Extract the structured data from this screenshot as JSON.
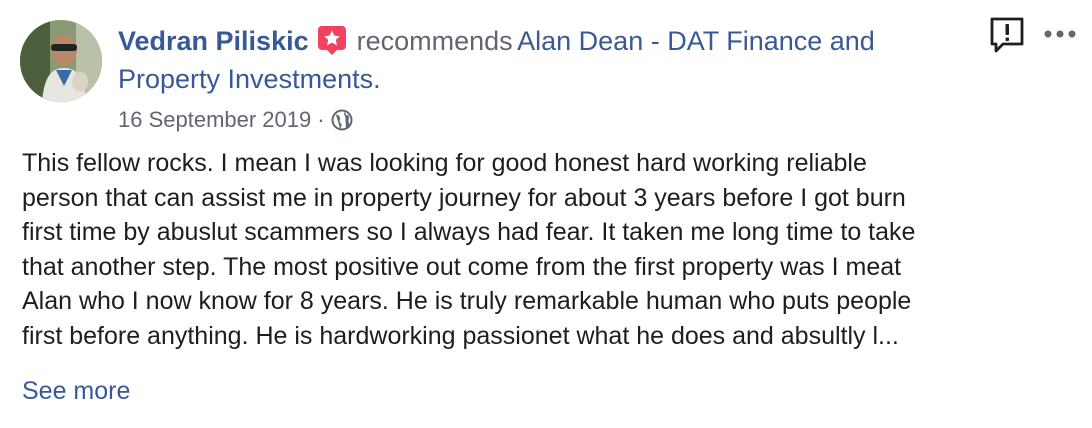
{
  "author": {
    "name": "Vedran Piliskic",
    "avatar_icon": "profile-photo",
    "badge_icon": "recommendation-star-icon"
  },
  "action_text": "recommends",
  "page_name_line1": "Alan Dean - DAT Finance and",
  "page_name_line2": "Property Investments.",
  "timestamp": "16 September 2019",
  "separator": "·",
  "privacy_icon": "globe-icon",
  "body_lines": [
    "This fellow rocks. I mean I was looking for good honest hard working reliable",
    "person that can assist me in property journey for about 3 years before I got burn",
    "first time by abuslut scammers so I always had fear. It taken me long time to take",
    "that another step. The most positive out come from the first property was I meat",
    "Alan who I now know for 8 years. He is truly remarkable human who puts people",
    "first before anything. He is hardworking passionet what he does and absultly l..."
  ],
  "see_more_label": "See more",
  "actions": {
    "report_icon": "report-icon",
    "more_icon": "more-options-icon"
  },
  "colors": {
    "link": "#385898",
    "secondary": "#606770",
    "badge": "#f3425f",
    "text": "#1c1e21"
  }
}
